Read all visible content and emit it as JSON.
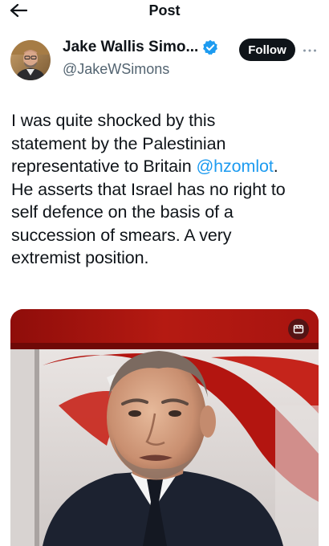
{
  "header": {
    "title": "Post",
    "back_icon": "arrow-left-icon"
  },
  "author": {
    "display_name": "Jake Wallis Simo...",
    "handle": "@JakeWSimons",
    "verified_icon": "verified-badge-icon",
    "follow_label": "Follow",
    "more_icon": "more-horizontal-icon"
  },
  "tweet": {
    "lines": [
      {
        "text": "I was quite shocked by this"
      },
      {
        "text": "statement by the Palestinian"
      },
      {
        "text": "representative to Britain ",
        "mention": "@hzomlot",
        "after": "."
      },
      {
        "text": "He asserts that Israel has no right to"
      },
      {
        "text": "self defence on the basis of a"
      },
      {
        "text": "succession of smears. A very"
      },
      {
        "text": "extremist position."
      }
    ]
  },
  "media": {
    "type": "video-still",
    "badge_icon": "media-overlay-icon"
  },
  "colors": {
    "accent": "#1d9bf0",
    "text": "#0f1419",
    "secondary": "#536471",
    "follow_bg": "#0f1419",
    "media_red": "#b51a12"
  }
}
